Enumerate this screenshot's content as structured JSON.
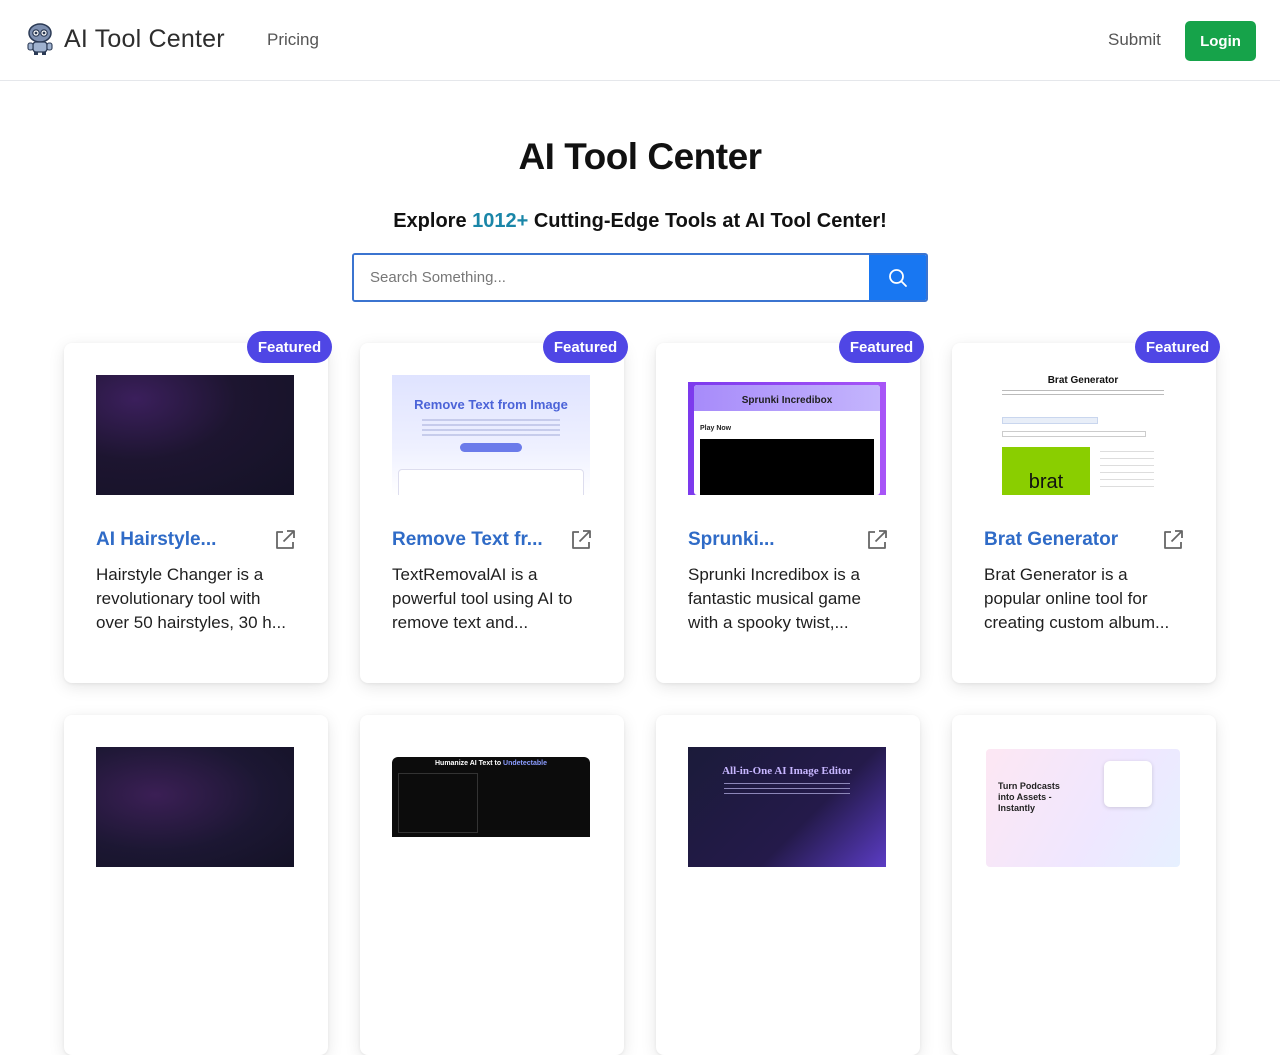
{
  "header": {
    "logo_text": "AI Tool Center",
    "nav_pricing": "Pricing",
    "nav_submit": "Submit",
    "login_label": "Login",
    "colors": {
      "login": "#16a34a"
    }
  },
  "hero": {
    "title": "AI Tool Center",
    "sub_prefix": "Explore ",
    "sub_count": "1012+",
    "sub_suffix": " Cutting-Edge Tools at AI Tool Center!",
    "accent_color": "#1a86a8"
  },
  "search": {
    "placeholder": "Search Something...",
    "value": "",
    "button_icon": "search-icon"
  },
  "cards": [
    {
      "badge": "Featured",
      "title": "AI Hairstyle...",
      "description": "Hairstyle Changer is a revolutionary tool with over 50 hairstyles, 30 h...",
      "thumb": ""
    },
    {
      "badge": "Featured",
      "title": "Remove Text fr...",
      "description": "TextRemovalAI is a powerful tool using AI to remove text and...",
      "thumb": "Remove Text from Image"
    },
    {
      "badge": "Featured",
      "title": "Sprunki...",
      "description": "Sprunki Incredibox is a fantastic musical game with a spooky twist,...",
      "thumb": "Sprunki Incredibox",
      "thumb_sub": "Play Now"
    },
    {
      "badge": "Featured",
      "title": "Brat Generator",
      "description": "Brat Generator is a popular online tool for creating custom album...",
      "thumb": "Brat Generator",
      "thumb_word": "brat"
    }
  ],
  "cards_row2": [
    {
      "thumb": ""
    },
    {
      "thumb_prefix": "Humanize AI Text to ",
      "thumb_hl": "Undetectable"
    },
    {
      "thumb": "All-in-One AI Image Editor"
    },
    {
      "thumb": "Turn Podcasts into Assets - Instantly"
    }
  ],
  "colors": {
    "badge": "#4f46e5",
    "title_link": "#2f6bc7",
    "search_button": "#1877f2",
    "search_border": "#3b74d0"
  }
}
